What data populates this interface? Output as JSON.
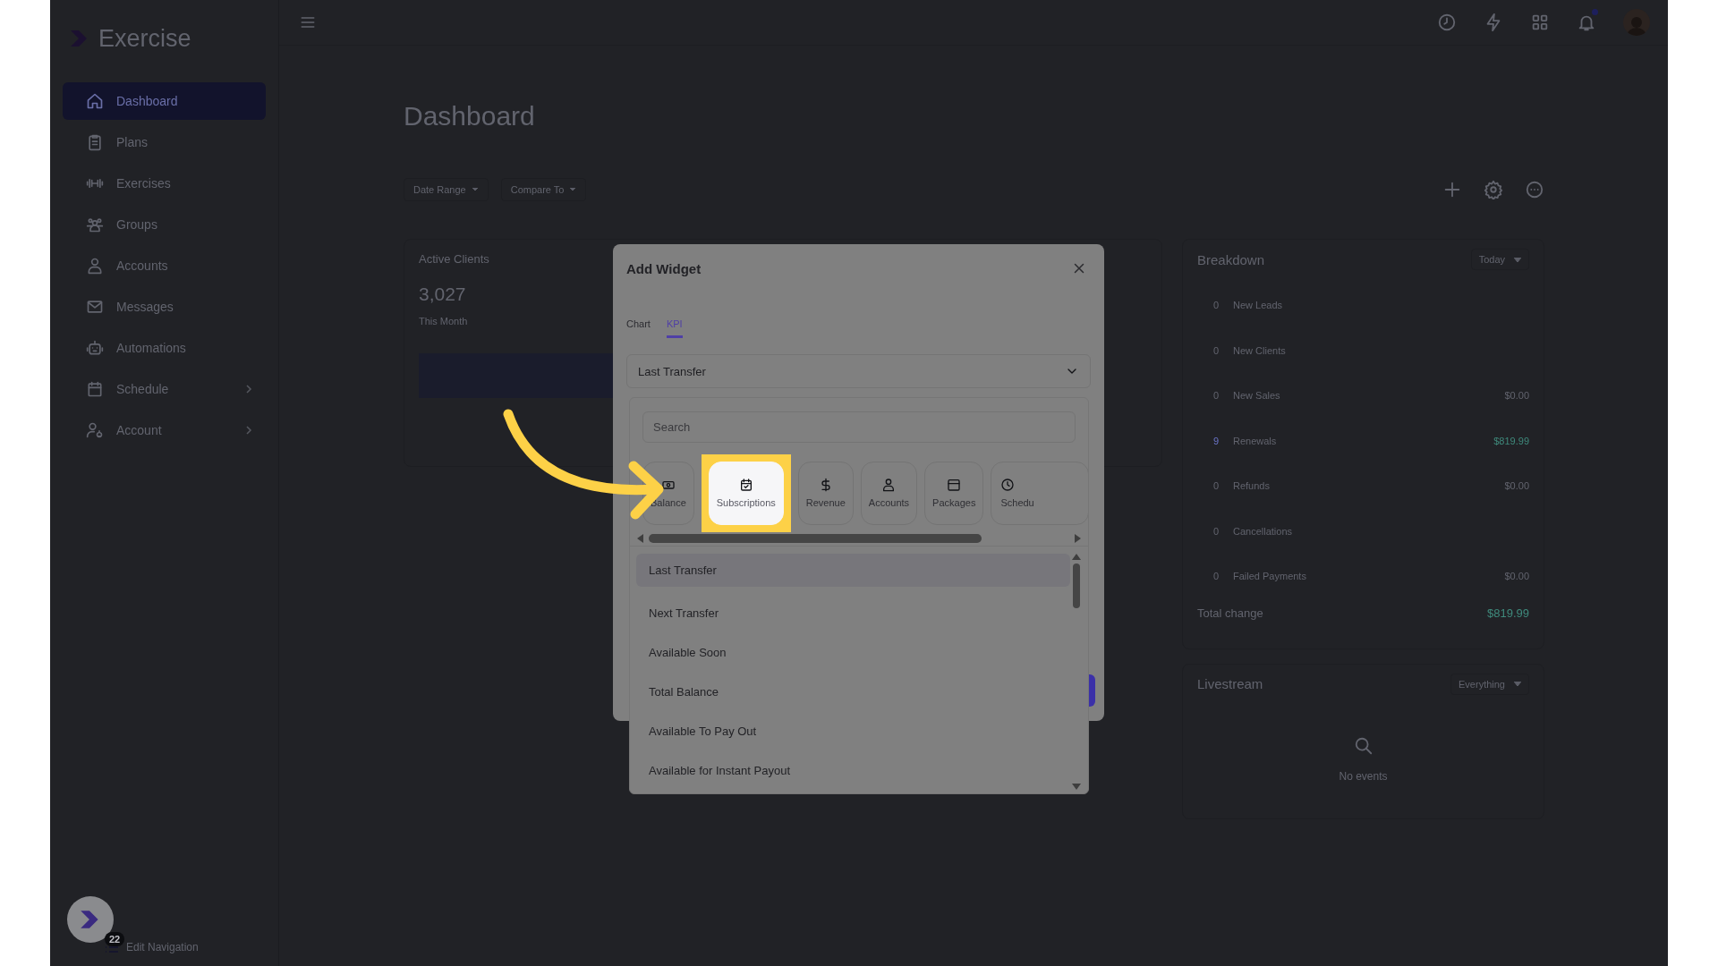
{
  "app": {
    "name": "Exercise"
  },
  "sidebar": {
    "items": [
      {
        "label": "Dashboard",
        "selected": true,
        "expandable": false
      },
      {
        "label": "Plans",
        "selected": false,
        "expandable": false
      },
      {
        "label": "Exercises",
        "selected": false,
        "expandable": false
      },
      {
        "label": "Groups",
        "selected": false,
        "expandable": false
      },
      {
        "label": "Accounts",
        "selected": false,
        "expandable": false
      },
      {
        "label": "Messages",
        "selected": false,
        "expandable": false
      },
      {
        "label": "Automations",
        "selected": false,
        "expandable": false
      },
      {
        "label": "Schedule",
        "selected": false,
        "expandable": true
      },
      {
        "label": "Account",
        "selected": false,
        "expandable": true
      }
    ],
    "badge": "22",
    "edit_link": "Edit Navigation"
  },
  "page": {
    "title": "Dashboard",
    "filters": [
      "Date Range",
      "Compare To"
    ]
  },
  "kpi_card": {
    "title": "Active Clients",
    "value": "3,027",
    "period": "This Month"
  },
  "breakdown": {
    "title": "Breakdown",
    "range": "Today",
    "rows": [
      {
        "count": "0",
        "label": "New Leads",
        "positive": false
      },
      {
        "count": "0",
        "label": "New Clients",
        "positive": false
      },
      {
        "count": "0",
        "label": "New Sales",
        "value": "$0.00",
        "positive": false
      },
      {
        "count": "9",
        "label": "Renewals",
        "value": "$819.99",
        "positive": true
      },
      {
        "count": "0",
        "label": "Refunds",
        "value": "$0.00",
        "positive": false
      },
      {
        "count": "0",
        "label": "Cancellations",
        "positive": false
      },
      {
        "count": "0",
        "label": "Failed Payments",
        "value": "$0.00",
        "positive": false
      }
    ],
    "total_label": "Total change",
    "total_value": "$819.99",
    "total_positive": true
  },
  "livestream": {
    "title": "Livestream",
    "filter": "Everything",
    "empty_text": "No events"
  },
  "modal": {
    "title": "Add Widget",
    "tabs": [
      {
        "label": "Chart",
        "selected": false
      },
      {
        "label": "KPI",
        "selected": true
      }
    ],
    "select_value": "Last Transfer",
    "search": {
      "placeholder": "Search"
    },
    "categories": [
      {
        "label": "Balance",
        "highlighted": false
      },
      {
        "label": "Subscriptions",
        "highlighted": true
      },
      {
        "label": "Revenue",
        "highlighted": false
      },
      {
        "label": "Accounts",
        "highlighted": false
      },
      {
        "label": "Packages",
        "highlighted": false
      },
      {
        "label": "Schedu",
        "highlighted": false
      }
    ],
    "options": [
      {
        "label": "Last Transfer",
        "selected": true
      },
      {
        "label": "Next Transfer",
        "selected": false
      },
      {
        "label": "Available Soon",
        "selected": false
      },
      {
        "label": "Total Balance",
        "selected": false
      },
      {
        "label": "Available To Pay Out",
        "selected": false
      },
      {
        "label": "Available for Instant Payout",
        "selected": false
      }
    ]
  }
}
